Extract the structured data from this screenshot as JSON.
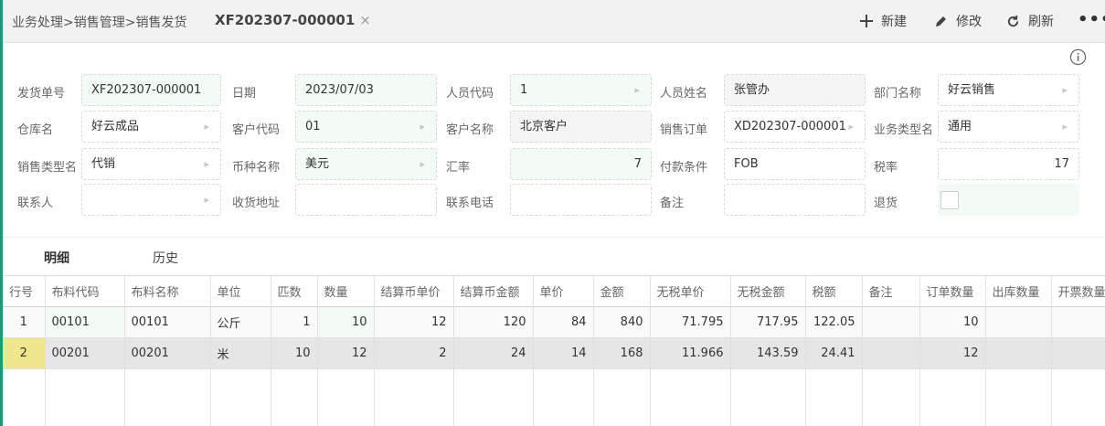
{
  "header": {
    "breadcrumb": "业务处理>销售管理>销售发货",
    "doc_tab": "XF202307-000001",
    "close": "×",
    "new_label": "新建",
    "edit_label": "修改",
    "refresh_label": "刷新",
    "more": "•••"
  },
  "form": {
    "fields": [
      {
        "label": "发货单号",
        "value": "XF202307-000001"
      },
      {
        "label": "日期",
        "value": "2023/07/03"
      },
      {
        "label": "人员代码",
        "value": "1"
      },
      {
        "label": "人员姓名",
        "value": "张管办"
      },
      {
        "label": "部门名称",
        "value": "好云销售"
      },
      {
        "label": "仓库名",
        "value": "好云成品"
      },
      {
        "label": "客户代码",
        "value": "01"
      },
      {
        "label": "客户名称",
        "value": "北京客户"
      },
      {
        "label": "销售订单",
        "value": "XD202307-000001"
      },
      {
        "label": "业务类型名",
        "value": "通用"
      },
      {
        "label": "销售类型名",
        "value": "代销"
      },
      {
        "label": "币种名称",
        "value": "美元"
      },
      {
        "label": "汇率",
        "value": "7"
      },
      {
        "label": "付款条件",
        "value": "FOB"
      },
      {
        "label": "税率",
        "value": "17"
      },
      {
        "label": "联系人",
        "value": ""
      },
      {
        "label": "收货地址",
        "value": ""
      },
      {
        "label": "联系电话",
        "value": ""
      },
      {
        "label": "备注",
        "value": ""
      },
      {
        "label": "退货",
        "value": ""
      }
    ]
  },
  "tabs": [
    {
      "label": "明细"
    },
    {
      "label": "历史"
    }
  ],
  "table": {
    "columns": [
      "行号",
      "布料代码",
      "布料名称",
      "单位",
      "匹数",
      "数量",
      "结算币单价",
      "结算币金额",
      "单价",
      "金额",
      "无税单价",
      "无税金额",
      "税额",
      "备注",
      "订单数量",
      "出库数量",
      "开票数量"
    ],
    "rows": [
      [
        "1",
        "00101",
        "00101",
        "公斤",
        "1",
        "10",
        "12",
        "120",
        "84",
        "840",
        "71.795",
        "717.95",
        "122.05",
        "",
        "10",
        "",
        ""
      ],
      [
        "2",
        "00201",
        "00201",
        "米",
        "10",
        "12",
        "2",
        "24",
        "14",
        "168",
        "11.966",
        "143.59",
        "24.41",
        "",
        "12",
        "",
        ""
      ]
    ]
  },
  "colors": {
    "accent": "#1a9c7a",
    "editable_bg": "#f3fcf4",
    "selected_row": "#e6e6e6",
    "row_marker": "#f0e68c"
  },
  "icons": [
    "plus-icon",
    "pencil-icon",
    "refresh-icon",
    "more-icon",
    "info-icon",
    "chevron-right-icon"
  ]
}
